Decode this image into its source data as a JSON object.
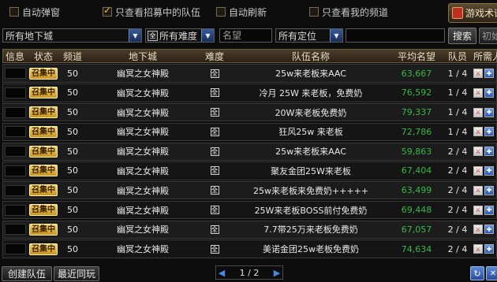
{
  "options": [
    {
      "label": "自动弹窗",
      "checked": false
    },
    {
      "label": "只查看招募中的队伍",
      "checked": true
    },
    {
      "label": "自动刷新",
      "checked": false
    },
    {
      "label": "只查看我的频道",
      "checked": false
    }
  ],
  "guide_button": "游戏术语",
  "filters": {
    "dungeon": "所有地下城",
    "difficulty": "所有难度",
    "reputation_placeholder": "名望",
    "position": "所有定位",
    "search": "搜索",
    "reset": "初始化"
  },
  "columns": [
    "信息",
    "状态",
    "频道",
    "地下城",
    "难度",
    "队伍名称",
    "平均名望",
    "队员",
    "所需人员"
  ],
  "difficulty_icon": "全",
  "rows": [
    {
      "status": "召集中",
      "channel": "50",
      "dungeon": "幽冥之女神殿",
      "name": "25w来老板来AAC",
      "reputation": "63,667",
      "members": "1 / 4"
    },
    {
      "status": "召集中",
      "channel": "50",
      "dungeon": "幽冥之女神殿",
      "name": "冷月 25W 来老板，免费奶",
      "reputation": "76,592",
      "members": "1 / 4"
    },
    {
      "status": "召集中",
      "channel": "50",
      "dungeon": "幽冥之女神殿",
      "name": "20W来老板免费奶",
      "reputation": "79,337",
      "members": "1 / 4"
    },
    {
      "status": "召集中",
      "channel": "50",
      "dungeon": "幽冥之女神殿",
      "name": "狂风25w 来老板",
      "reputation": "72,786",
      "members": "1 / 4"
    },
    {
      "status": "召集中",
      "channel": "50",
      "dungeon": "幽冥之女神殿",
      "name": "25w来老板来AAC",
      "reputation": "59,863",
      "members": "2 / 4"
    },
    {
      "status": "召集中",
      "channel": "50",
      "dungeon": "幽冥之女神殿",
      "name": "聚友金团25W来老板",
      "reputation": "67,404",
      "members": "2 / 4"
    },
    {
      "status": "召集中",
      "channel": "50",
      "dungeon": "幽冥之女神殿",
      "name": "25w来老板来免费奶+++++",
      "reputation": "63,499",
      "members": "2 / 4"
    },
    {
      "status": "召集中",
      "channel": "50",
      "dungeon": "幽冥之女神殿",
      "name": "25W来老板BOSS前付免费奶",
      "reputation": "69,448",
      "members": "2 / 4"
    },
    {
      "status": "召集中",
      "channel": "50",
      "dungeon": "幽冥之女神殿",
      "name": "7.7带25万来老板免费奶",
      "reputation": "67,057",
      "members": "2 / 4"
    },
    {
      "status": "召集中",
      "channel": "50",
      "dungeon": "幽冥之女神殿",
      "name": "美诺金团25w老板免费奶",
      "reputation": "74,634",
      "members": "2 / 4"
    }
  ],
  "bottom": {
    "create": "创建队伍",
    "recent": "最近同玩",
    "page": "1 / 2"
  },
  "colors": {
    "accent": "#f0c040",
    "reputation": "#38b848",
    "header": "#4a3e2c"
  }
}
